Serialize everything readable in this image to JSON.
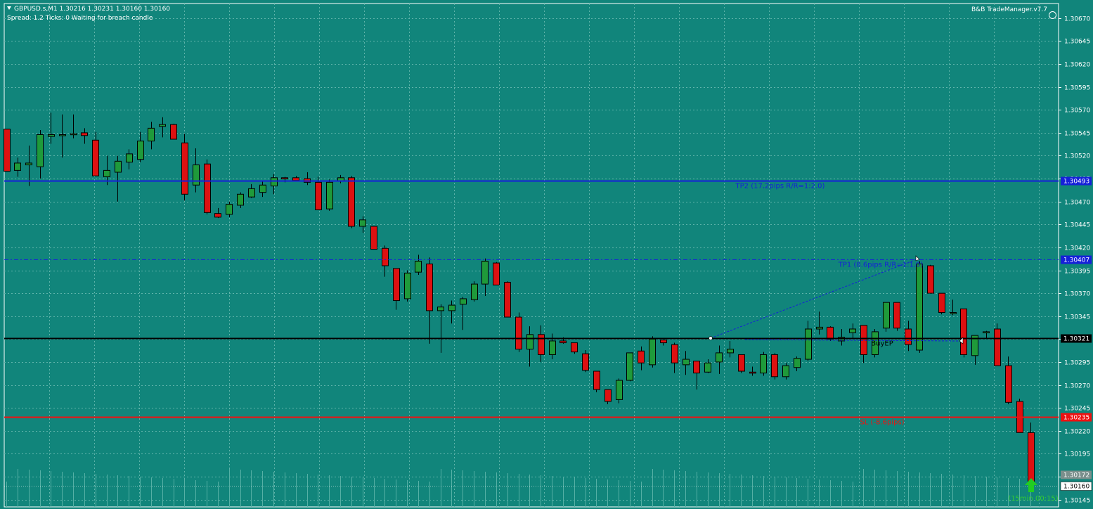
{
  "header": {
    "symbol_line": "GBPUSD.s,M1  1.30216 1.30231 1.30160 1.30160",
    "status_line": "Spread: 1.2   Ticks: 0   Waiting for breach candle",
    "brand": "B&B TradeManager.v7.7"
  },
  "colors": {
    "background": "#11857b",
    "grid": "#5fb3aa",
    "bull": "#1f9a3a",
    "bear": "#dd1111",
    "wick": "#000000",
    "tp_line": "#1520d8",
    "entry_line": "#000000",
    "sl_line": "#ee1111"
  },
  "chart_data": {
    "type": "candlestick",
    "ylim": [
      1.30137,
      1.30686
    ],
    "y_ticks": [
      "1.30670",
      "1.30645",
      "1.30620",
      "1.30595",
      "1.30570",
      "1.30545",
      "1.30520",
      "1.30495",
      "1.30470",
      "1.30445",
      "1.30420",
      "1.30395",
      "1.30370",
      "1.30345",
      "1.30320",
      "1.30295",
      "1.30270",
      "1.30245",
      "1.30220",
      "1.30195",
      "1.30170",
      "1.30145"
    ],
    "candles": [
      [
        1.30549,
        1.30549,
        1.30503,
        1.30503
      ],
      [
        1.30504,
        1.30518,
        1.30497,
        1.30512
      ],
      [
        1.3051,
        1.30531,
        1.30487,
        1.30512
      ],
      [
        1.30508,
        1.30548,
        1.30495,
        1.30543
      ],
      [
        1.30541,
        1.30567,
        1.30533,
        1.30543
      ],
      [
        1.30543,
        1.30565,
        1.30518,
        1.30543
      ],
      [
        1.30544,
        1.30565,
        1.30539,
        1.30544
      ],
      [
        1.30545,
        1.3055,
        1.30533,
        1.30542
      ],
      [
        1.30537,
        1.30546,
        1.30498,
        1.30498
      ],
      [
        1.30497,
        1.3052,
        1.30488,
        1.30504
      ],
      [
        1.30502,
        1.3052,
        1.3047,
        1.30514
      ],
      [
        1.30513,
        1.30527,
        1.30505,
        1.30522
      ],
      [
        1.30516,
        1.30546,
        1.30513,
        1.30536
      ],
      [
        1.30536,
        1.30557,
        1.30527,
        1.3055
      ],
      [
        1.30552,
        1.30562,
        1.3054,
        1.30554
      ],
      [
        1.30554,
        1.30555,
        1.30538,
        1.30538
      ],
      [
        1.30534,
        1.30544,
        1.30471,
        1.30478
      ],
      [
        1.30488,
        1.30528,
        1.3048,
        1.3051
      ],
      [
        1.30511,
        1.30516,
        1.30456,
        1.30458
      ],
      [
        1.30457,
        1.30463,
        1.30452,
        1.30453
      ],
      [
        1.30456,
        1.3047,
        1.30453,
        1.30467
      ],
      [
        1.30466,
        1.3048,
        1.30463,
        1.30478
      ],
      [
        1.30475,
        1.30489,
        1.30474,
        1.30484
      ],
      [
        1.3048,
        1.30492,
        1.30475,
        1.30488
      ],
      [
        1.30487,
        1.305,
        1.30478,
        1.30496
      ],
      [
        1.30496,
        1.30497,
        1.30491,
        1.30495
      ],
      [
        1.30496,
        1.30498,
        1.30492,
        1.30493
      ],
      [
        1.30495,
        1.30502,
        1.30488,
        1.30491
      ],
      [
        1.30491,
        1.30497,
        1.30461,
        1.30461
      ],
      [
        1.30462,
        1.30494,
        1.3046,
        1.30491
      ],
      [
        1.30492,
        1.30499,
        1.3049,
        1.30496
      ],
      [
        1.30496,
        1.30498,
        1.30441,
        1.30443
      ],
      [
        1.30443,
        1.30454,
        1.30436,
        1.3045
      ],
      [
        1.30443,
        1.30443,
        1.30418,
        1.30418
      ],
      [
        1.30419,
        1.30422,
        1.30388,
        1.304
      ],
      [
        1.30397,
        1.30397,
        1.30352,
        1.30362
      ],
      [
        1.30364,
        1.30395,
        1.30361,
        1.30392
      ],
      [
        1.30393,
        1.30412,
        1.3039,
        1.30405
      ],
      [
        1.30402,
        1.30409,
        1.30315,
        1.30351
      ],
      [
        1.30351,
        1.30358,
        1.30305,
        1.30355
      ],
      [
        1.30351,
        1.30362,
        1.30337,
        1.30357
      ],
      [
        1.30358,
        1.30366,
        1.3033,
        1.30364
      ],
      [
        1.30363,
        1.30383,
        1.30361,
        1.3038
      ],
      [
        1.3038,
        1.30408,
        1.30367,
        1.30405
      ],
      [
        1.30403,
        1.30404,
        1.30379,
        1.30379
      ],
      [
        1.30382,
        1.30383,
        1.30344,
        1.30344
      ],
      [
        1.30344,
        1.30349,
        1.30306,
        1.30309
      ],
      [
        1.30309,
        1.30334,
        1.3029,
        1.30325
      ],
      [
        1.30325,
        1.30335,
        1.30295,
        1.30303
      ],
      [
        1.30303,
        1.30326,
        1.30298,
        1.30318
      ],
      [
        1.30318,
        1.30322,
        1.30315,
        1.30316
      ],
      [
        1.30316,
        1.30312,
        1.30304,
        1.30306
      ],
      [
        1.30304,
        1.30308,
        1.30284,
        1.30286
      ],
      [
        1.30285,
        1.30285,
        1.30262,
        1.30265
      ],
      [
        1.30265,
        1.30264,
        1.30249,
        1.30252
      ],
      [
        1.30254,
        1.30277,
        1.3025,
        1.30275
      ],
      [
        1.30275,
        1.30305,
        1.30274,
        1.30305
      ],
      [
        1.30307,
        1.30312,
        1.30286,
        1.30294
      ],
      [
        1.30292,
        1.30323,
        1.30289,
        1.3032
      ],
      [
        1.30319,
        1.30319,
        1.30313,
        1.30316
      ],
      [
        1.30314,
        1.30316,
        1.30283,
        1.30294
      ],
      [
        1.30292,
        1.30307,
        1.30281,
        1.30298
      ],
      [
        1.30296,
        1.30296,
        1.30265,
        1.30283
      ],
      [
        1.30284,
        1.30298,
        1.30283,
        1.30294
      ],
      [
        1.30295,
        1.30313,
        1.30282,
        1.30305
      ],
      [
        1.30305,
        1.30318,
        1.303,
        1.30309
      ],
      [
        1.30303,
        1.30303,
        1.30283,
        1.30285
      ],
      [
        1.30284,
        1.3029,
        1.3028,
        1.30283
      ],
      [
        1.30283,
        1.30306,
        1.3028,
        1.30303
      ],
      [
        1.30303,
        1.30305,
        1.30276,
        1.30279
      ],
      [
        1.30279,
        1.30294,
        1.30276,
        1.30291
      ],
      [
        1.30289,
        1.30301,
        1.30285,
        1.30299
      ],
      [
        1.30298,
        1.3034,
        1.30296,
        1.30331
      ],
      [
        1.30331,
        1.3035,
        1.30325,
        1.30333
      ],
      [
        1.30333,
        1.30334,
        1.30318,
        1.3032
      ],
      [
        1.30318,
        1.30331,
        1.30313,
        1.30322
      ],
      [
        1.30327,
        1.30337,
        1.3032,
        1.30331
      ],
      [
        1.30335,
        1.30335,
        1.30294,
        1.30303
      ],
      [
        1.30303,
        1.30331,
        1.303,
        1.30328
      ],
      [
        1.30332,
        1.3036,
        1.30328,
        1.3036
      ],
      [
        1.3036,
        1.3036,
        1.30329,
        1.30332
      ],
      [
        1.30331,
        1.3034,
        1.30307,
        1.30314
      ],
      [
        1.30308,
        1.30405,
        1.30305,
        1.30402
      ],
      [
        1.304,
        1.30401,
        1.30373,
        1.3037
      ],
      [
        1.3037,
        1.3037,
        1.30347,
        1.30349
      ],
      [
        1.30349,
        1.30363,
        1.30346,
        1.30349
      ],
      [
        1.30353,
        1.30353,
        1.303,
        1.30303
      ],
      [
        1.30302,
        1.30322,
        1.30292,
        1.30324
      ],
      [
        1.30327,
        1.30329,
        1.3032,
        1.30328
      ],
      [
        1.30331,
        1.30337,
        1.30293,
        1.30291
      ],
      [
        1.30291,
        1.30301,
        1.30249,
        1.30251
      ],
      [
        1.30252,
        1.30255,
        1.30218,
        1.30218
      ],
      [
        1.30218,
        1.30229,
        1.30163,
        1.30163
      ]
    ],
    "levels": [
      {
        "name": "tp2",
        "price": 1.30493,
        "price_label": "1.30493",
        "text": "TP2 (17.2pips R/R=1:2.0)",
        "style": "solid"
      },
      {
        "name": "tp1",
        "price": 1.30407,
        "price_label": "1.30407",
        "text": "TP1 (8.6pips R/R=1:1.0)",
        "style": "dashdot"
      },
      {
        "name": "entry",
        "price": 1.30321,
        "price_label": "1.30321",
        "text": "BuyEP",
        "style": "solid"
      },
      {
        "name": "sl",
        "price": 1.30235,
        "price_label": "1.30235",
        "text": "SL (-8.6pips)",
        "style": "solid"
      }
    ],
    "ask_label": "1.30172",
    "bid_label": "1.30160",
    "timer_text": "(15min 00:15)"
  }
}
